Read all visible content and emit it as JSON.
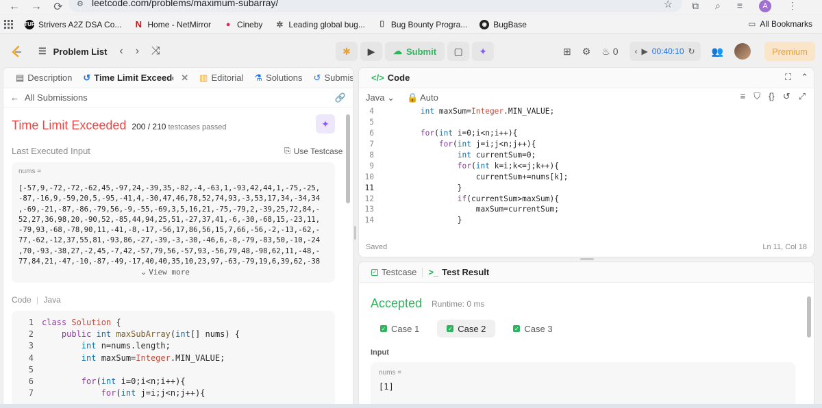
{
  "browser": {
    "url": "leetcode.com/problems/maximum-subarray/",
    "bookmarks": [
      {
        "label": "Strivers A2Z DSA Co...",
        "icon": "tuf-icon",
        "color": "#111111"
      },
      {
        "label": "Home - NetMirror",
        "icon": "netmirror-icon",
        "color": "#e50914"
      },
      {
        "label": "Cineby",
        "icon": "cineby-icon",
        "color": "#e0245e"
      },
      {
        "label": "Leading global bug...",
        "icon": "bugcrowd-icon",
        "color": "#555555"
      },
      {
        "label": "Bug Bounty Progra...",
        "icon": "bookmark-icon",
        "color": "#555555"
      },
      {
        "label": "BugBase",
        "icon": "bugbase-icon",
        "color": "#222222"
      }
    ],
    "all_bookmarks": "All Bookmarks",
    "avatar_letter": "A"
  },
  "nav": {
    "problem_list": "Problem List",
    "submit": "Submit",
    "streak": "0",
    "timer": "00:40:10",
    "premium": "Premium"
  },
  "left": {
    "tabs": [
      "Description",
      "Time Limit Exceeded",
      "Editorial",
      "Solutions",
      "Submissions"
    ],
    "all_submissions": "All Submissions",
    "status": "Time Limit Exceeded",
    "passed": "200 / 210",
    "passed_suffix": "testcases passed",
    "last_executed": "Last Executed Input",
    "use_testcase": "Use Testcase",
    "nums_label": "nums =",
    "nums_lines": [
      "[-57,9,-72,-72,-62,45,-97,24,-39,35,-82,-4,-63,1,-93,42,44,1,-75,-25,",
      "-87,-16,9,-59,20,5,-95,-41,4,-30,47,46,78,52,74,93,-3,53,17,34,-34,34",
      ",-69,-21,-87,-86,-79,56,-9,-55,-69,3,5,16,21,-75,-79,2,-39,25,72,84,-",
      "52,27,36,98,20,-90,52,-85,44,94,25,51,-27,37,41,-6,-30,-68,15,-23,11,",
      "-79,93,-68,-78,90,11,-41,-8,-17,-56,17,86,56,15,7,66,-56,-2,-13,-62,-",
      "77,-62,-12,37,55,81,-93,86,-27,-39,-3,-30,-46,6,-8,-79,-83,50,-10,-24",
      ",70,-93,-38,27,-2,45,-7,42,-57,79,56,-57,93,-56,79,48,-98,62,11,-48,-",
      "77,84,21,-47,-10,-87,-49,-17,40,40,35,10,23,97,-63,-79,19,6,39,62,-38"
    ],
    "view_more": "View more",
    "code_label": "Code",
    "lang": "Java",
    "code_lines": [
      {
        "n": "1",
        "text": "class Solution {"
      },
      {
        "n": "2",
        "text": "    public int maxSubArray(int[] nums) {"
      },
      {
        "n": "3",
        "text": "        int n=nums.length;"
      },
      {
        "n": "4",
        "text": "        int maxSum=Integer.MIN_VALUE;"
      },
      {
        "n": "5",
        "text": ""
      },
      {
        "n": "6",
        "text": "        for(int i=0;i<n;i++){"
      },
      {
        "n": "7",
        "text": "            for(int j=i;j<n;j++){"
      }
    ]
  },
  "code_panel": {
    "title": "Code",
    "lang": "Java",
    "mode": "Auto",
    "lines": [
      {
        "n": "4",
        "text": "        int maxSum=Integer.MIN_VALUE;"
      },
      {
        "n": "5",
        "text": ""
      },
      {
        "n": "6",
        "text": "        for(int i=0;i<n;i++){"
      },
      {
        "n": "7",
        "text": "            for(int j=i;j<n;j++){"
      },
      {
        "n": "8",
        "text": "                int currentSum=0;"
      },
      {
        "n": "9",
        "text": "                for(int k=i;k<=j;k++){"
      },
      {
        "n": "10",
        "text": "                    currentSum+=nums[k];"
      },
      {
        "n": "11",
        "text": "                }"
      },
      {
        "n": "12",
        "text": "                if(currentSum>maxSum){"
      },
      {
        "n": "13",
        "text": "                    maxSum=currentSum;"
      },
      {
        "n": "14",
        "text": "                }"
      }
    ],
    "saved": "Saved",
    "position": "Ln 11, Col 18"
  },
  "test_panel": {
    "tab_testcase": "Testcase",
    "tab_result": "Test Result",
    "status": "Accepted",
    "runtime": "Runtime: 0 ms",
    "cases": [
      "Case 1",
      "Case 2",
      "Case 3"
    ],
    "input_label": "Input",
    "nums_label": "nums =",
    "nums_value": "[1]"
  },
  "colors": {
    "tle": "#ef4743",
    "accepted": "#2db55d",
    "accent": "#1a73e8"
  }
}
